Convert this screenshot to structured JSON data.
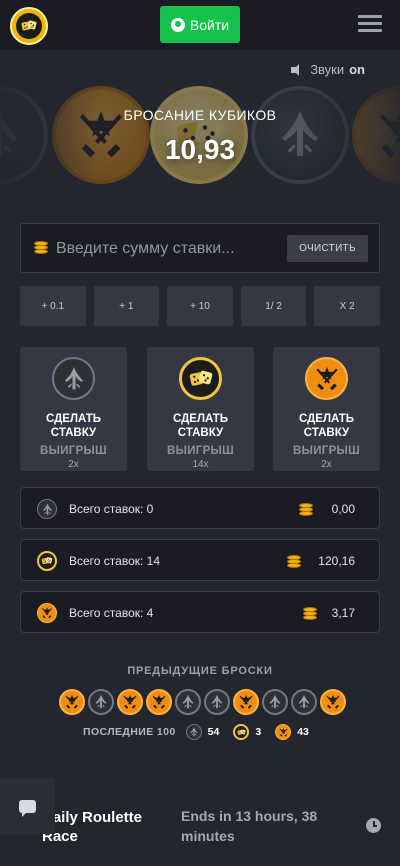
{
  "header": {
    "login_label": "Войти",
    "logo_icon": "dice-icon",
    "menu_icon": "hamburger-menu-icon"
  },
  "sound": {
    "label": "Звуки",
    "state": "on"
  },
  "roll": {
    "title": "БРОСАНИЕ КУБИКОВ",
    "value": "10,93"
  },
  "bet": {
    "placeholder": "Введите сумму ставки...",
    "value": "",
    "clear_label": "ОЧИСТИТЬ",
    "modifiers": [
      "+ 0.1",
      "+ 1",
      "+ 10",
      "1/ 2",
      "X 2"
    ]
  },
  "cards": [
    {
      "side": "ct",
      "line1": "СДЕЛАТЬ",
      "line2": "СТАВКУ",
      "win_label": "ВЫИГРЫШ",
      "multiplier": "2x"
    },
    {
      "side": "dice",
      "line1": "СДЕЛАТЬ",
      "line2": "СТАВКУ",
      "win_label": "ВЫИГРЫШ",
      "multiplier": "14x"
    },
    {
      "side": "t",
      "line1": "СДЕЛАТЬ",
      "line2": "СТАВКУ",
      "win_label": "ВЫИГРЫШ",
      "multiplier": "2x"
    }
  ],
  "totals": [
    {
      "side": "ct",
      "label": "Всего ставок: 0",
      "amount": "0,00"
    },
    {
      "side": "dice",
      "label": "Всего ставок: 14",
      "amount": "120,16"
    },
    {
      "side": "t",
      "label": "Всего ставок: 4",
      "amount": "3,17"
    }
  ],
  "previous": {
    "title": "ПРЕДЫДУЩИЕ БРОСКИ",
    "rolls": [
      "t",
      "ct",
      "t",
      "t",
      "ct",
      "ct",
      "t",
      "ct",
      "ct",
      "t"
    ],
    "last_label": "ПОСЛЕДНИЕ 100",
    "counts": {
      "ct": "54",
      "dice": "3",
      "t": "43"
    }
  },
  "race": {
    "title": "Daily Roulette Race",
    "ends": "Ends in 13 hours, 38 minutes"
  },
  "colors": {
    "background": "#23252f",
    "panel": "#1b1c23",
    "button": "#353844",
    "accent_green": "#17c24c",
    "t_orange": "#ef8e12",
    "dice_gold": "#f3c53a"
  }
}
